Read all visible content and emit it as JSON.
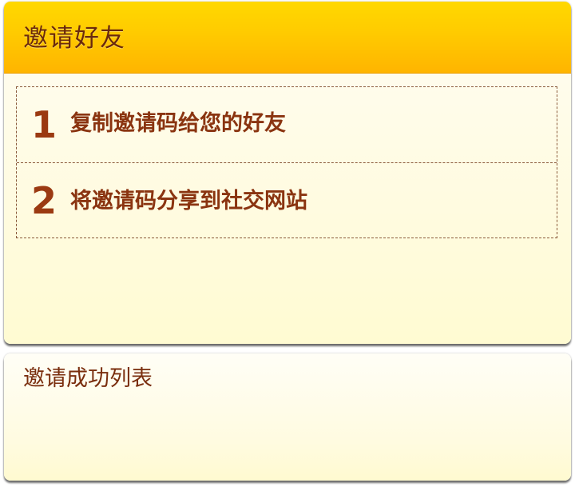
{
  "invite_panel": {
    "title": "邀请好友",
    "steps": [
      {
        "number": "1",
        "text": "复制邀请码给您的好友"
      },
      {
        "number": "2",
        "text": "将邀请码分享到社交网站"
      }
    ]
  },
  "success_list": {
    "title": "邀请成功列表"
  },
  "colors": {
    "header_gradient_top": "#ffd800",
    "header_gradient_bottom": "#ffb400",
    "title_brown": "#6b2a0c",
    "step_text_brown": "#8a3410",
    "panel_background": "#fffbe0"
  }
}
